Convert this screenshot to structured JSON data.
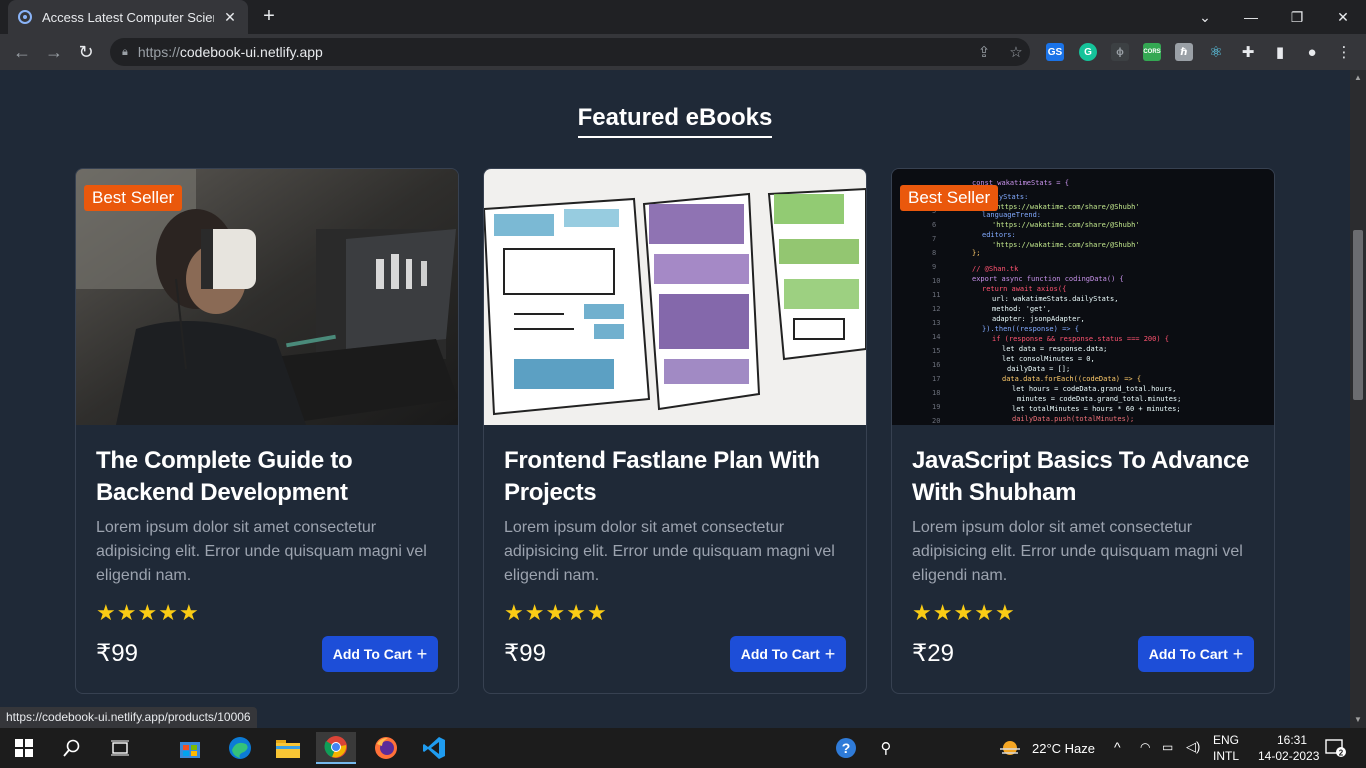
{
  "browser": {
    "tab_title": "Access Latest Computer Science eBooks",
    "url_scheme": "https://",
    "url_host": "codebook-ui.netlify.app",
    "status_url": "https://codebook-ui.netlify.app/products/10006",
    "extensions": [
      "GS",
      "G",
      "ϕ",
      "CORS",
      "ℏ",
      "⚛"
    ]
  },
  "page": {
    "section_title": "Featured eBooks",
    "products": [
      {
        "title": "The Complete Guide to Backend Development",
        "description": "Lorem ipsum dolor sit amet consectetur adipisicing elit. Error unde quisquam magni vel eligendi nam.",
        "badge": "Best Seller",
        "rating": 5,
        "price": "₹99",
        "cart_label": "Add To Cart",
        "image": "person-drinking-coffee-at-laptop"
      },
      {
        "title": "Frontend Fastlane Plan With Projects",
        "description": "Lorem ipsum dolor sit amet consectetur adipisicing elit. Error unde quisquam magni vel eligendi nam.",
        "badge": "",
        "rating": 5,
        "price": "₹99",
        "cart_label": "Add To Cart",
        "image": "watercolor-wireframe-sketches"
      },
      {
        "title": "JavaScript Basics To Advance With Shubham",
        "description": "Lorem ipsum dolor sit amet consectetur adipisicing elit. Error unde quisquam magni vel eligendi nam.",
        "badge": "Best Seller",
        "rating": 5,
        "price": "₹29",
        "cart_label": "Add To Cart",
        "image": "code-editor-screen"
      }
    ]
  },
  "taskbar": {
    "weather": "22°C  Haze",
    "lang_top": "ENG",
    "lang_bottom": "INTL",
    "time": "16:31",
    "date": "14-02-2023",
    "notifications": "2"
  },
  "colors": {
    "page_bg": "#1f2937",
    "badge": "#ea580c",
    "button": "#1d4ed8",
    "star": "#facc15"
  }
}
